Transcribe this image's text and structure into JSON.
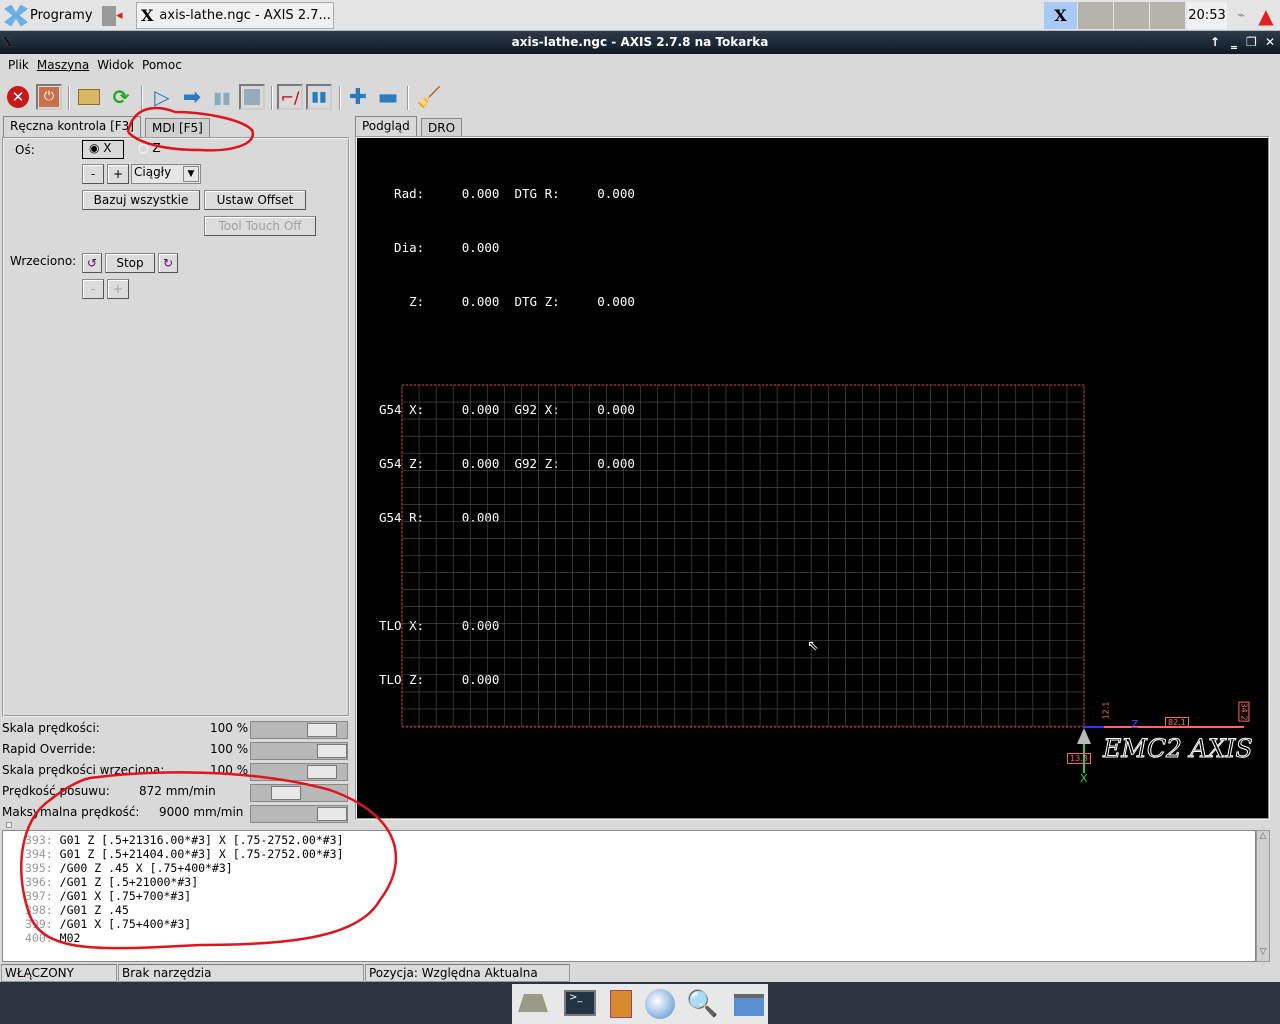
{
  "taskbar": {
    "start_label": "Programy",
    "window_task": "axis-lathe.ngc - AXIS 2.7...",
    "clock": "20:53"
  },
  "window": {
    "title": "axis-lathe.ngc - AXIS 2.7.8 na Tokarka"
  },
  "menu": [
    "Plik",
    "Maszyna",
    "Widok",
    "Pomoc"
  ],
  "left_tabs": [
    "Ręczna kontrola [F3]",
    "MDI [F5]"
  ],
  "manual": {
    "axis_label": "Oś:",
    "axis_x": "X",
    "axis_z": "Z",
    "selected_axis": "X",
    "minus": "-",
    "plus": "+",
    "jog_mode": "Ciągły",
    "home_all": "Bazuj wszystkie",
    "set_offset": "Ustaw Offset",
    "touch_off": "Tool Touch Off",
    "spindle_label": "Wrzeciono:",
    "spindle_stop": "Stop"
  },
  "overrides": [
    {
      "label": "Skala prędkości:",
      "value": "100 %",
      "level": 0.7
    },
    {
      "label": "Rapid Override:",
      "value": "100 %",
      "level": 1.0
    },
    {
      "label": "Skala prędkości wrzeciona:",
      "value": "100 %",
      "level": 0.7
    },
    {
      "label": "Prędkość posuwu:",
      "value": "872 mm/min",
      "level": 0.3
    },
    {
      "label": "Maksymalna prędkość:",
      "value": "9000 mm/min",
      "level": 1.0
    }
  ],
  "right_tabs": [
    "Podgląd",
    "DRO"
  ],
  "dro": [
    "  Rad:     0.000  DTG R:     0.000",
    "  Dia:     0.000",
    "    Z:     0.000  DTG Z:     0.000",
    "",
    "G54 X:     0.000  G92 X:     0.000",
    "G54 Z:     0.000  G92 Z:     0.000",
    "G54 R:     0.000",
    "",
    "TLO X:     0.000",
    "TLO Z:     0.000"
  ],
  "preview": {
    "logo": "EMC2 AXIS",
    "axis_z": "Z",
    "axis_x": "X",
    "dim_top": "82.1",
    "dim_left": "13.3",
    "dim_small": "12.1",
    "dim_right": "34.2",
    "grid_color": "#555555",
    "limits_color": "#ff3333"
  },
  "gcode": [
    {
      "n": "393:",
      "code": "G01 Z [.5+21316.00*#3] X [.75-2752.00*#3]"
    },
    {
      "n": "394:",
      "code": "G01 Z [.5+21404.00*#3] X [.75-2752.00*#3]"
    },
    {
      "n": "395:",
      "code": "/G00 Z .45 X [.75+400*#3]"
    },
    {
      "n": "396:",
      "code": "/G01 Z [.5+21000*#3]"
    },
    {
      "n": "397:",
      "code": "/G01 X [.75+700*#3]"
    },
    {
      "n": "398:",
      "code": "/G01 Z .45"
    },
    {
      "n": "399:",
      "code": "/G01 X [.75+400*#3]"
    },
    {
      "n": "400:",
      "code": "M02"
    }
  ],
  "status": {
    "machine": "WŁĄCZONY",
    "tool": "Brak narzędzia",
    "position": "Pozycja: Względna Aktualna"
  }
}
